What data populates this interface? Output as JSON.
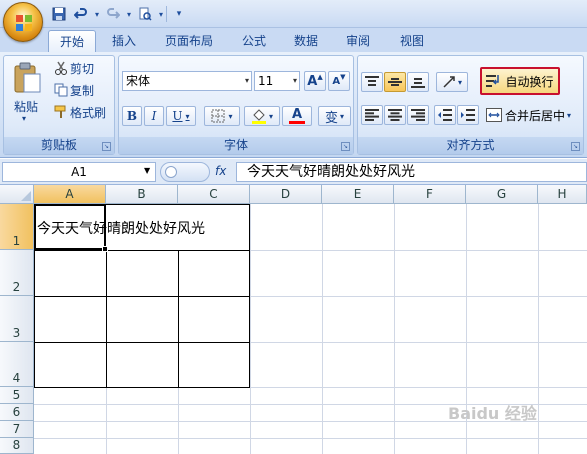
{
  "quick_access": {
    "save_icon": "save-icon",
    "undo_icon": "undo-icon",
    "redo_icon": "redo-icon",
    "preview_icon": "print-preview-icon",
    "customize_icon": "customize-arrow-icon"
  },
  "tabs": [
    {
      "label": "开始",
      "active": true
    },
    {
      "label": "插入"
    },
    {
      "label": "页面布局"
    },
    {
      "label": "公式"
    },
    {
      "label": "数据"
    },
    {
      "label": "审阅"
    },
    {
      "label": "视图"
    }
  ],
  "clipboard": {
    "group_label": "剪贴板",
    "paste_label": "粘贴",
    "cut_label": "剪切",
    "copy_label": "复制",
    "format_painter_label": "格式刷"
  },
  "font": {
    "group_label": "字体",
    "font_name": "宋体",
    "font_size": "11",
    "bold": "B",
    "italic": "I",
    "underline": "U",
    "grow": "A",
    "shrink": "A",
    "font_color_glyph": "A",
    "phonetic": "变"
  },
  "alignment": {
    "group_label": "对齐方式",
    "wrap_text_label": "自动换行",
    "merge_center_label": "合并后居中"
  },
  "formula_bar": {
    "name_box": "A1",
    "fx": "fx",
    "formula": "今天天气好晴朗处处好风光"
  },
  "sheet": {
    "columns": [
      "A",
      "B",
      "C",
      "D",
      "E",
      "F",
      "G",
      "H"
    ],
    "rows": [
      "1",
      "2",
      "3",
      "4",
      "5",
      "6",
      "7",
      "8"
    ],
    "selected_cell": "A1",
    "a1_value": "今天天气好晴朗处处好风光"
  },
  "watermark": "Baidu 经验",
  "colors": {
    "ribbon_bg": "#d5e3f6",
    "highlight_box": "#c8102e",
    "selected_header": "#f1c15f"
  }
}
